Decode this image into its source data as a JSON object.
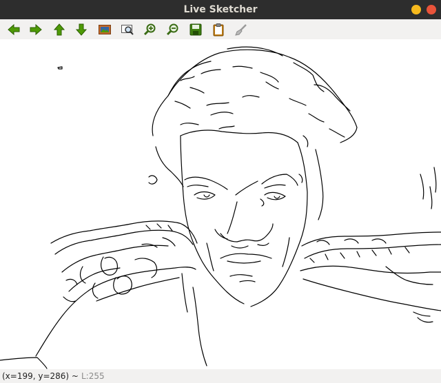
{
  "window": {
    "title": "Live Sketcher"
  },
  "toolbar": {
    "icons": [
      "arrow-left-icon",
      "arrow-right-icon",
      "arrow-up-icon",
      "arrow-down-icon",
      "image-icon",
      "zoom-fit-icon",
      "zoom-in-icon",
      "zoom-out-icon",
      "save-icon",
      "clipboard-icon",
      "brush-icon"
    ]
  },
  "status": {
    "coords": "(x=199, y=286) ~",
    "level": "L:255"
  },
  "colors": {
    "titlebar": "#2d2d2d",
    "minimize": "#f6b91d",
    "close": "#e9533a",
    "arrow_green": "#4e9a06"
  }
}
